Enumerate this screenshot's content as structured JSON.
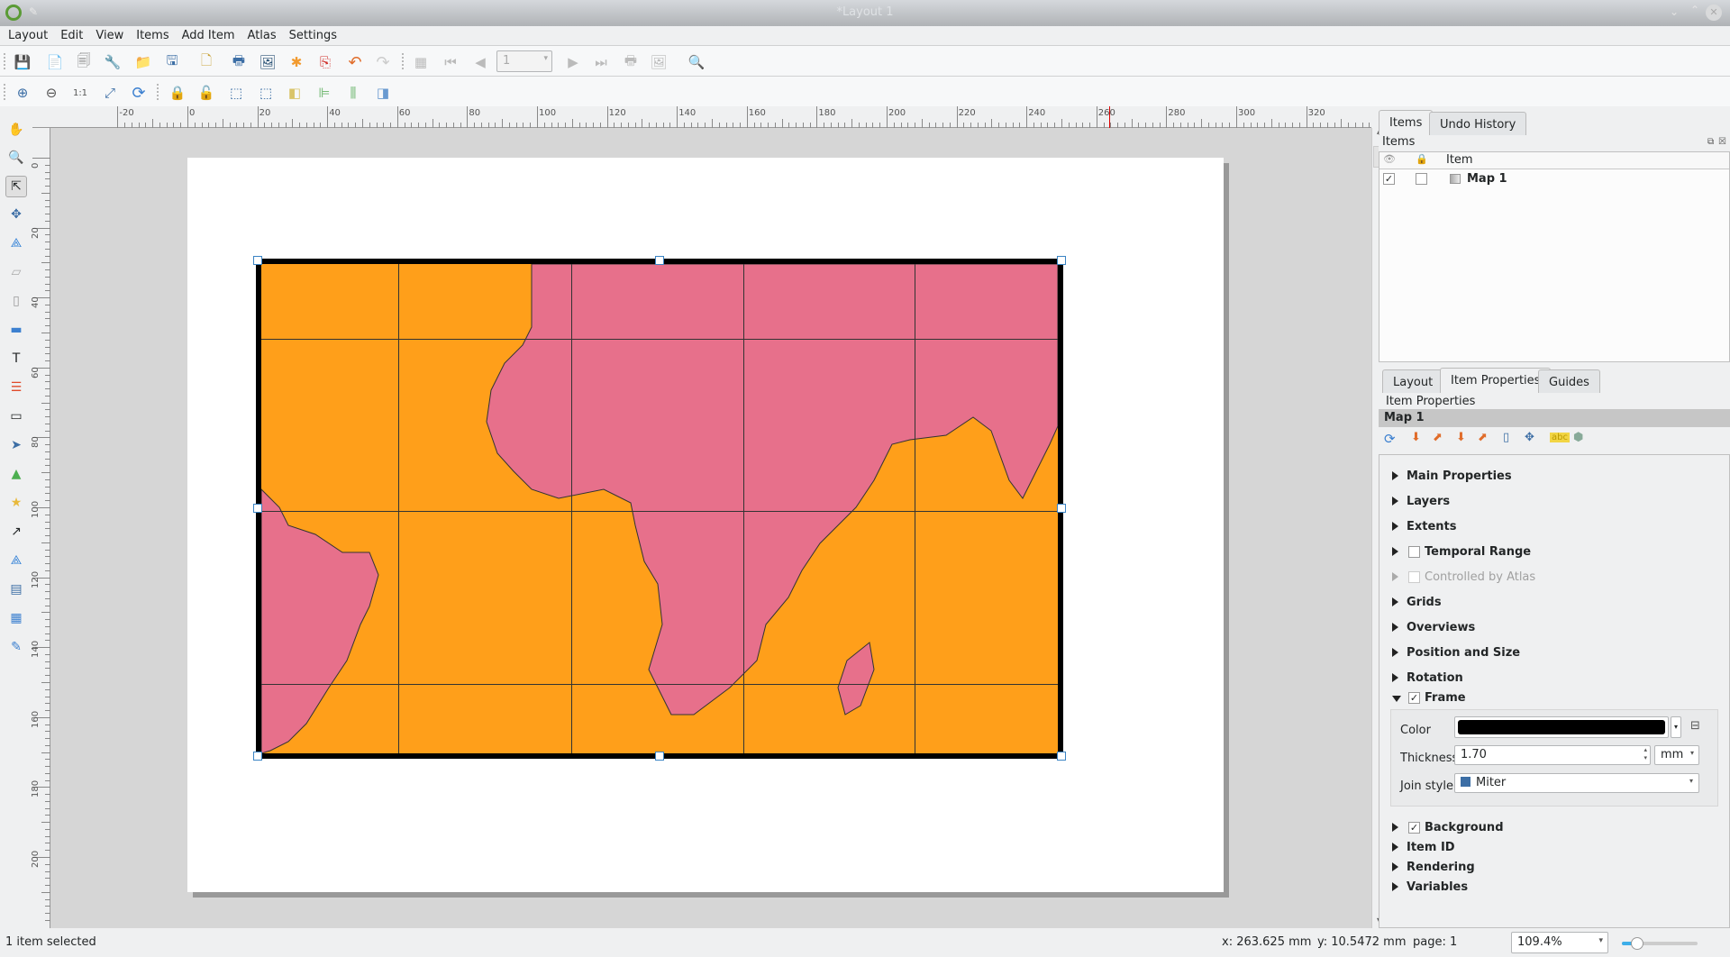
{
  "window": {
    "title": "*Layout 1"
  },
  "menu": [
    "Layout",
    "Edit",
    "View",
    "Items",
    "Add Item",
    "Atlas",
    "Settings"
  ],
  "toolbar1": {
    "icons": [
      "save-layout",
      "new-layout",
      "duplicate-layout",
      "layout-manager",
      "open-template",
      "save-as-template",
      "new-page",
      "print",
      "export-image",
      "export-svg",
      "export-pdf",
      "undo",
      "redo",
      "atlas-preview",
      "atlas-first",
      "atlas-previous",
      "atlas-next",
      "atlas-last",
      "atlas-print",
      "atlas-export",
      "atlas-settings"
    ],
    "atlas_page_value": "1"
  },
  "toolbar2": {
    "icons": [
      "zoom-in",
      "zoom-out",
      "zoom-100",
      "zoom-full",
      "refresh-view",
      "lock-items",
      "unlock-items",
      "select-all",
      "deselect",
      "raise-items",
      "align-left",
      "distribute",
      "resize"
    ]
  },
  "toolbox": [
    "pan",
    "zoom",
    "select-move-item",
    "move-content",
    "edit-nodes",
    "add-3d-map",
    "add-map",
    "add-picture",
    "add-label",
    "add-legend",
    "add-scale-bar",
    "add-north-arrow",
    "add-shape",
    "add-marker",
    "add-arrow",
    "add-node-item",
    "add-html",
    "add-attribute-table",
    "add-fixed-table"
  ],
  "rulers": {
    "horizontal": [
      "-20",
      "0",
      "20",
      "40",
      "60",
      "80",
      "100",
      "120",
      "140",
      "160",
      "180",
      "200",
      "220",
      "240",
      "260",
      "280",
      "300",
      "320"
    ],
    "vertical": [
      "0",
      "20",
      "40",
      "60",
      "80",
      "100",
      "120",
      "140",
      "160",
      "180",
      "200"
    ]
  },
  "map": {
    "ocean_color": "#ff9f1a",
    "land_color": "#e7708b",
    "frame_color": "#000000"
  },
  "items_panel": {
    "tabs": [
      "Items",
      "Undo History"
    ],
    "active_tab": "Items",
    "title": "Items",
    "columns": [
      "",
      "",
      "Item"
    ],
    "rows": [
      {
        "visible": true,
        "locked": false,
        "name": "Map 1"
      }
    ]
  },
  "props_panel": {
    "tabs": [
      "Layout",
      "Item Properties",
      "Guides"
    ],
    "active_tab": "Item Properties",
    "title": "Item Properties",
    "item_name": "Map 1",
    "sections": [
      {
        "label": "Main Properties"
      },
      {
        "label": "Layers"
      },
      {
        "label": "Extents"
      },
      {
        "label": "Temporal Range",
        "checkbox": false
      },
      {
        "label": "Controlled by Atlas",
        "checkbox": false,
        "disabled": true
      },
      {
        "label": "Grids"
      },
      {
        "label": "Overviews"
      },
      {
        "label": "Position and Size"
      },
      {
        "label": "Rotation"
      },
      {
        "label": "Frame",
        "checkbox": true,
        "expanded": true
      }
    ],
    "frame": {
      "color_label": "Color",
      "color": "#000000",
      "thickness_label": "Thickness",
      "thickness": "1.70",
      "unit": "mm",
      "join_label": "Join style",
      "join": "Miter"
    },
    "sections_after": [
      {
        "label": "Background",
        "checkbox": true
      },
      {
        "label": "Item ID"
      },
      {
        "label": "Rendering"
      },
      {
        "label": "Variables"
      }
    ]
  },
  "status": {
    "message": "1 item selected",
    "x": "x: 263.625 mm",
    "y": "y: 10.5472 mm",
    "page": "page: 1",
    "zoom": "109.4%"
  }
}
